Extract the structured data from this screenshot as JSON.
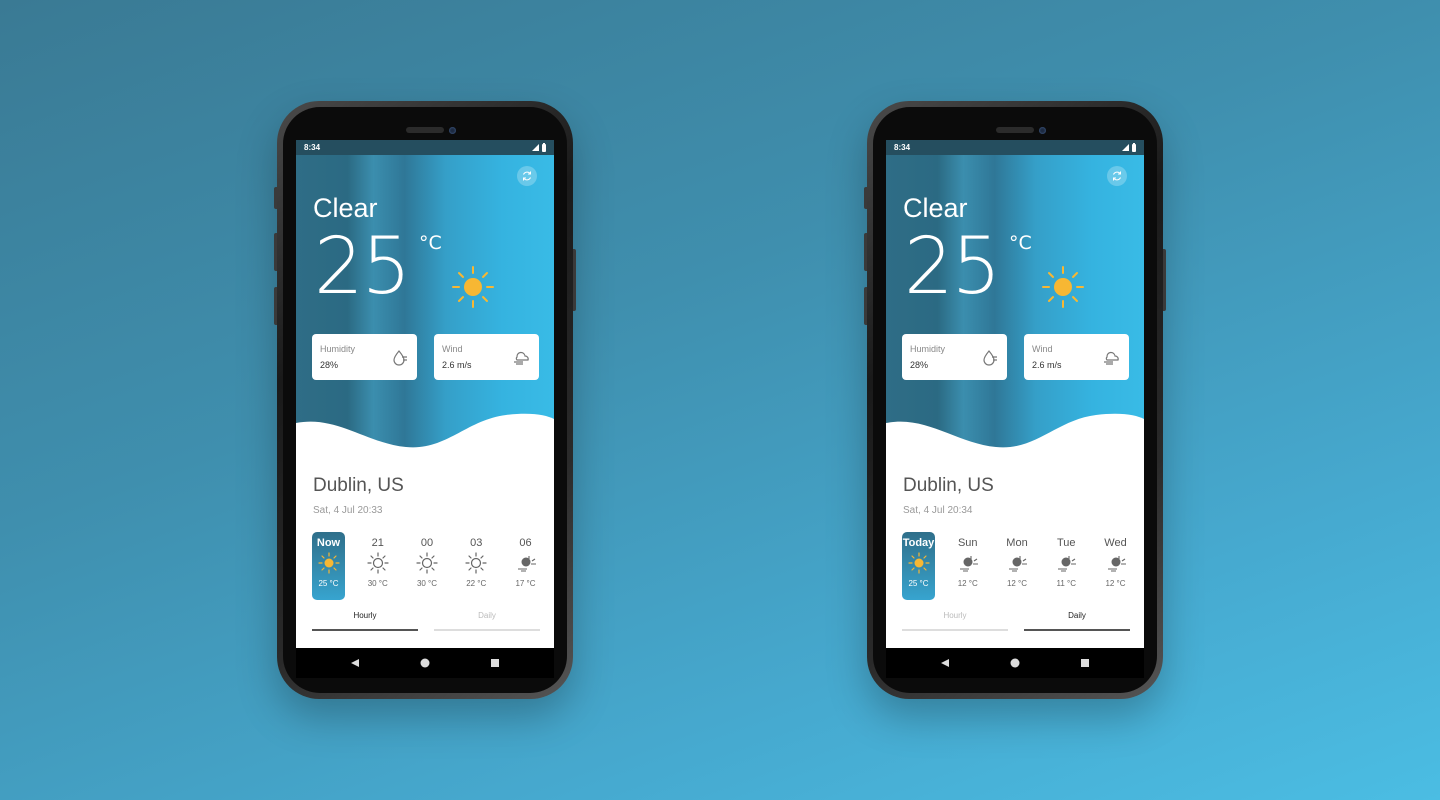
{
  "phones": [
    {
      "status_time": "8:34",
      "condition": "Clear",
      "temperature": "25",
      "unit": "°C",
      "humidity": {
        "label": "Humidity",
        "value": "28%",
        "icon": "humidity-icon"
      },
      "wind": {
        "label": "Wind",
        "value": "2.6 m/s",
        "icon": "wind-icon"
      },
      "city": "Dublin, US",
      "datetime": "Sat, 4 Jul 20:33",
      "forecast": [
        {
          "label": "Now",
          "temp": "25 °C",
          "icon": "sun-icon",
          "active": true
        },
        {
          "label": "21",
          "temp": "30 °C",
          "icon": "sun-outline-icon",
          "active": false
        },
        {
          "label": "00",
          "temp": "30 °C",
          "icon": "sun-outline-icon",
          "active": false
        },
        {
          "label": "03",
          "temp": "22 °C",
          "icon": "sun-outline-icon",
          "active": false
        },
        {
          "label": "06",
          "temp": "17 °C",
          "icon": "moon-wind-icon",
          "active": false
        }
      ],
      "tabs": [
        {
          "label": "Hourly",
          "active": true
        },
        {
          "label": "Daily",
          "active": false
        }
      ]
    },
    {
      "status_time": "8:34",
      "condition": "Clear",
      "temperature": "25",
      "unit": "°C",
      "humidity": {
        "label": "Humidity",
        "value": "28%",
        "icon": "humidity-icon"
      },
      "wind": {
        "label": "Wind",
        "value": "2.6 m/s",
        "icon": "wind-icon"
      },
      "city": "Dublin, US",
      "datetime": "Sat, 4 Jul 20:34",
      "forecast": [
        {
          "label": "Today",
          "temp": "25 °C",
          "icon": "sun-icon",
          "active": true
        },
        {
          "label": "Sun",
          "temp": "12 °C",
          "icon": "moon-wind-icon",
          "active": false
        },
        {
          "label": "Mon",
          "temp": "12 °C",
          "icon": "moon-wind-icon",
          "active": false
        },
        {
          "label": "Tue",
          "temp": "11 °C",
          "icon": "moon-wind-icon",
          "active": false
        },
        {
          "label": "Wed",
          "temp": "12 °C",
          "icon": "moon-wind-icon",
          "active": false
        }
      ],
      "tabs": [
        {
          "label": "Hourly",
          "active": false
        },
        {
          "label": "Daily",
          "active": true
        }
      ]
    }
  ],
  "colors": {
    "accent": "#35b3e0",
    "sun": "#f7b733",
    "hero_dark": "#2b6a83"
  }
}
